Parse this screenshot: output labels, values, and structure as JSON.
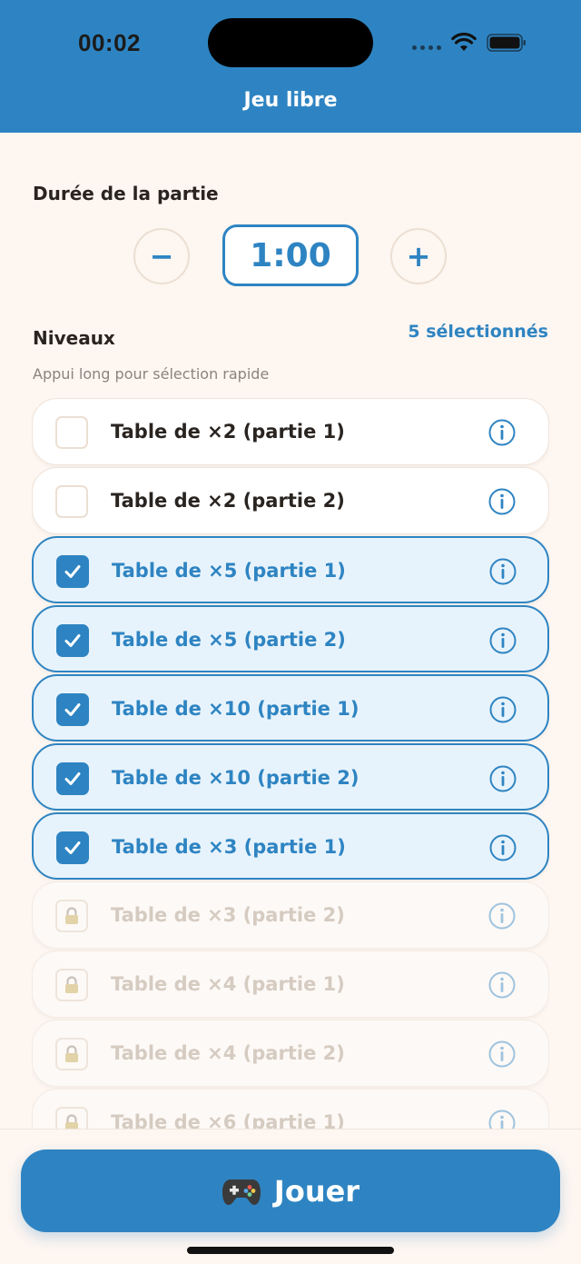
{
  "status_bar": {
    "time": "00:02"
  },
  "header": {
    "title": "Jeu libre"
  },
  "duration": {
    "label": "Durée de la partie",
    "value": "1:00",
    "minus_label": "−",
    "plus_label": "+"
  },
  "levels": {
    "label": "Niveaux",
    "selected_count": "5 sélectionnés",
    "hint": "Appui long pour sélection rapide",
    "items": [
      {
        "label": "Table de ×2 (partie 1)",
        "state": "unchecked"
      },
      {
        "label": "Table de ×2 (partie 2)",
        "state": "unchecked"
      },
      {
        "label": "Table de ×5 (partie 1)",
        "state": "selected"
      },
      {
        "label": "Table de ×5 (partie 2)",
        "state": "selected"
      },
      {
        "label": "Table de ×10 (partie 1)",
        "state": "selected"
      },
      {
        "label": "Table de ×10 (partie 2)",
        "state": "selected"
      },
      {
        "label": "Table de ×3 (partie 1)",
        "state": "selected"
      },
      {
        "label": "Table de ×3 (partie 2)",
        "state": "locked"
      },
      {
        "label": "Table de ×4 (partie 1)",
        "state": "locked"
      },
      {
        "label": "Table de ×4 (partie 2)",
        "state": "locked"
      },
      {
        "label": "Table de ×6 (partie 1)",
        "state": "locked"
      }
    ]
  },
  "play_button": {
    "label": "Jouer",
    "icon": "gamepad-icon"
  },
  "colors": {
    "accent": "#2e84c2",
    "background": "#fdf6f1",
    "selected_row": "#e7f3fc",
    "locked_text": "#d5cbc1"
  }
}
